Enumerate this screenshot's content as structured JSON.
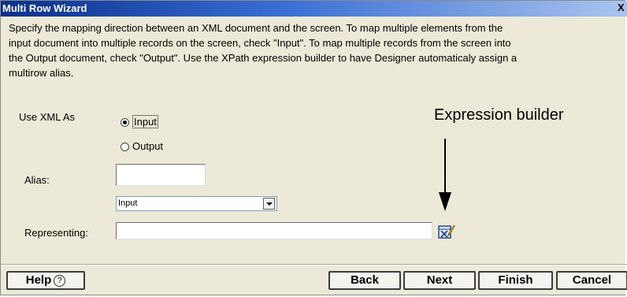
{
  "window": {
    "title": "Multi Row Wizard",
    "close_glyph": "X"
  },
  "description": {
    "lines": [
      "Specify the mapping direction between an XML document and the screen. To map multiple elements from the",
      "input document into multiple records on the screen, check \"Input\". To map multiple records from the screen into",
      "the Output document, check \"Output\". Use the XPath expression builder to have Designer automaticaly assign a",
      "multirow alias."
    ]
  },
  "form": {
    "use_xml_as_label": "Use XML As",
    "radio_input_label": "Input",
    "radio_output_label": "Output",
    "selected_radio": "Input",
    "alias_label": "Alias:",
    "alias_value": "",
    "select_value": "Input",
    "representing_label": "Representing:",
    "representing_value": ""
  },
  "annotation": {
    "text": "Expression builder"
  },
  "icons": {
    "expression_builder": "expression-builder-icon",
    "help": "help-circle-icon",
    "dropdown": "chevron-down-icon"
  },
  "buttons": {
    "help_label": "Help",
    "help_glyph": "?",
    "back_label": "Back",
    "next_label": "Next",
    "finish_label": "Finish",
    "cancel_label": "Cancel"
  },
  "colors": {
    "title_bar_start": "#0a2f8c",
    "title_bar_end": "#a9c4ee",
    "dialog_background": "#ece9d8"
  }
}
